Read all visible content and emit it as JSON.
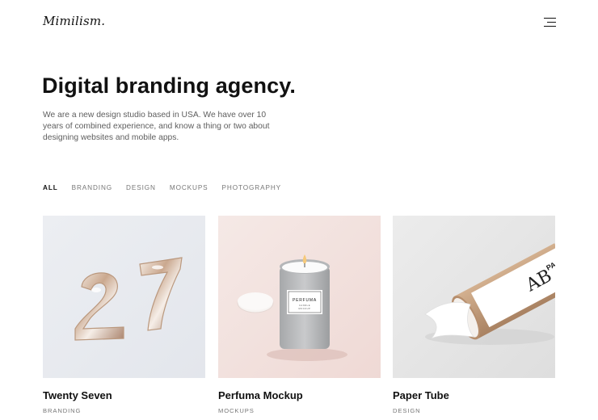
{
  "brand": {
    "logo_text": "Mimilism."
  },
  "hero": {
    "headline": "Digital branding agency.",
    "intro": "We are a new design studio based in USA. We have over 10 years of combined experience, and know a thing or two about designing websites and mobile apps."
  },
  "filters": [
    "ALL",
    "BRANDING",
    "DESIGN",
    "MOCKUPS",
    "PHOTOGRAPHY"
  ],
  "active_filter": "ALL",
  "portfolio": [
    {
      "title": "Twenty Seven",
      "category": "BRANDING",
      "image": "balloon-numbers-27"
    },
    {
      "title": "Perfuma Mockup",
      "category": "MOCKUPS",
      "image": "candle-jar"
    },
    {
      "title": "Paper Tube",
      "category": "DESIGN",
      "image": "paper-tube"
    }
  ],
  "image_text": {
    "candle_label": "PERFUMA",
    "candle_sub1": "CANDLE",
    "candle_sub2": "MOCKUP",
    "tube_mark": "AB",
    "tube_text": "PA"
  },
  "colors": {
    "text": "#111111",
    "muted": "#777777",
    "body": "#5e5e5e"
  },
  "icons": {
    "menu": "hamburger-menu-icon"
  }
}
